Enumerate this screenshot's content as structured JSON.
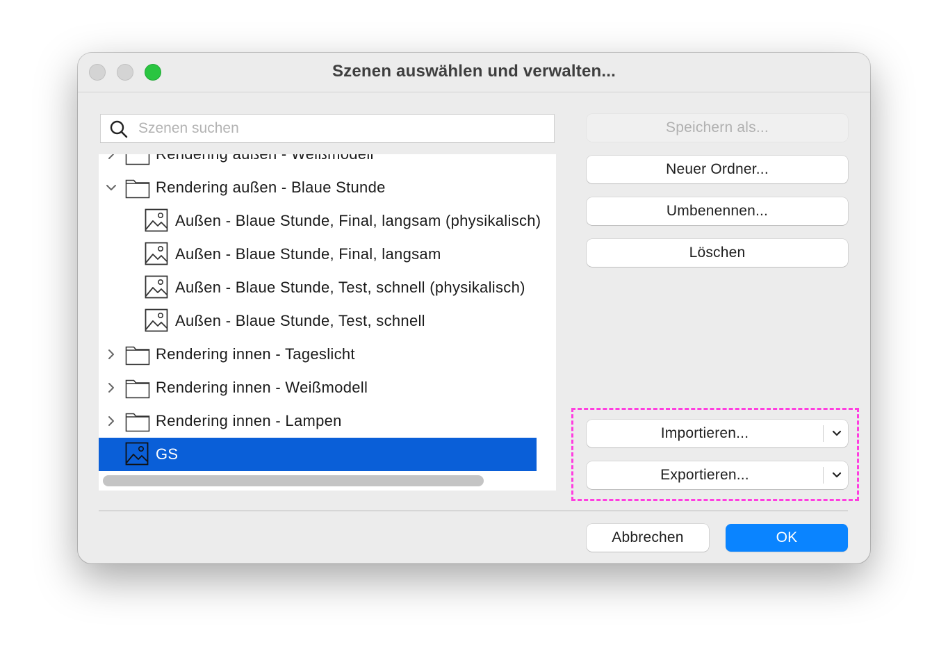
{
  "window": {
    "title": "Szenen auswählen und verwalten..."
  },
  "search": {
    "placeholder": "Szenen suchen",
    "value": ""
  },
  "tree": {
    "items": [
      {
        "type": "folder",
        "label": "Rendering außen - Weißmodell",
        "expanded": false
      },
      {
        "type": "folder",
        "label": "Rendering außen - Blaue Stunde",
        "expanded": true
      },
      {
        "type": "scene",
        "label": "Außen - Blaue Stunde, Final, langsam (physikalisch)"
      },
      {
        "type": "scene",
        "label": "Außen - Blaue Stunde, Final, langsam"
      },
      {
        "type": "scene",
        "label": "Außen - Blaue Stunde, Test, schnell (physikalisch)"
      },
      {
        "type": "scene",
        "label": "Außen - Blaue Stunde, Test, schnell"
      },
      {
        "type": "folder",
        "label": "Rendering innen - Tageslicht",
        "expanded": false
      },
      {
        "type": "folder",
        "label": "Rendering innen - Weißmodell",
        "expanded": false
      },
      {
        "type": "folder",
        "label": "Rendering innen - Lampen",
        "expanded": false
      },
      {
        "type": "scene",
        "label": "GS",
        "selected": true
      }
    ]
  },
  "buttons": {
    "save_as": "Speichern als...",
    "new_folder": "Neuer Ordner...",
    "rename": "Umbenennen...",
    "delete": "Löschen",
    "import": "Importieren...",
    "export": "Exportieren...",
    "cancel": "Abbrechen",
    "ok": "OK"
  },
  "colors": {
    "selection": "#0a5fd8",
    "accent": "#0a84ff",
    "highlight": "#ff3ee0",
    "close": "#d4d4d4",
    "minimize": "#d4d4d4",
    "zoom": "#2ac541"
  },
  "icons": {
    "search": "search-icon",
    "folder": "folder-icon",
    "scene": "image-icon",
    "expand": "chevron-right-icon",
    "collapse": "chevron-down-icon",
    "dropdown": "chevron-down-icon"
  }
}
